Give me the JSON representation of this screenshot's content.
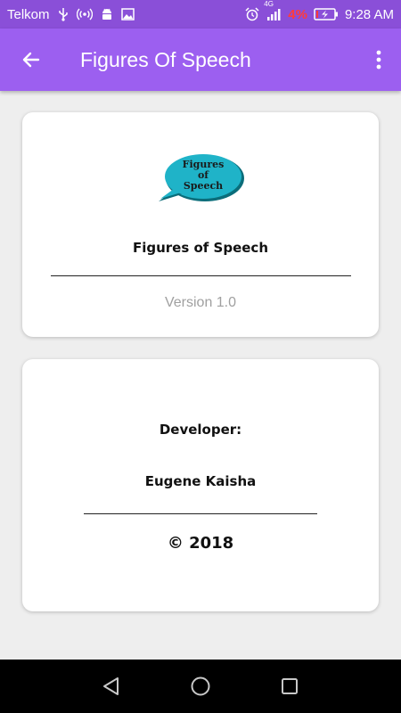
{
  "status_bar": {
    "carrier": "Telkom",
    "network": "4G",
    "battery_percent": "4%",
    "time": "9:28 AM",
    "icons": [
      "usb-icon",
      "hotspot-icon",
      "android-icon",
      "image-icon",
      "alarm-icon",
      "signal-icon",
      "battery-charging-icon"
    ]
  },
  "app_bar": {
    "title": "Figures Of Speech",
    "back_icon": "arrow-left-icon",
    "menu_icon": "more-vert-icon"
  },
  "about_card": {
    "logo_text": [
      "Figures",
      "of",
      "Speech"
    ],
    "app_name": "Figures of Speech",
    "version": "Version 1.0"
  },
  "developer_card": {
    "label": "Developer:",
    "name": "Eugene Kaisha",
    "copyright": "© 2018"
  },
  "nav_bar": {
    "icons": [
      "back-triangle-icon",
      "home-circle-icon",
      "recents-square-icon"
    ]
  },
  "colors": {
    "status_bar": "#8a4fd8",
    "app_bar": "#9c5ff0",
    "background": "#eeeeee",
    "logo_bubble": "#1fb3c8",
    "battery_low": "#ff3b3b"
  }
}
